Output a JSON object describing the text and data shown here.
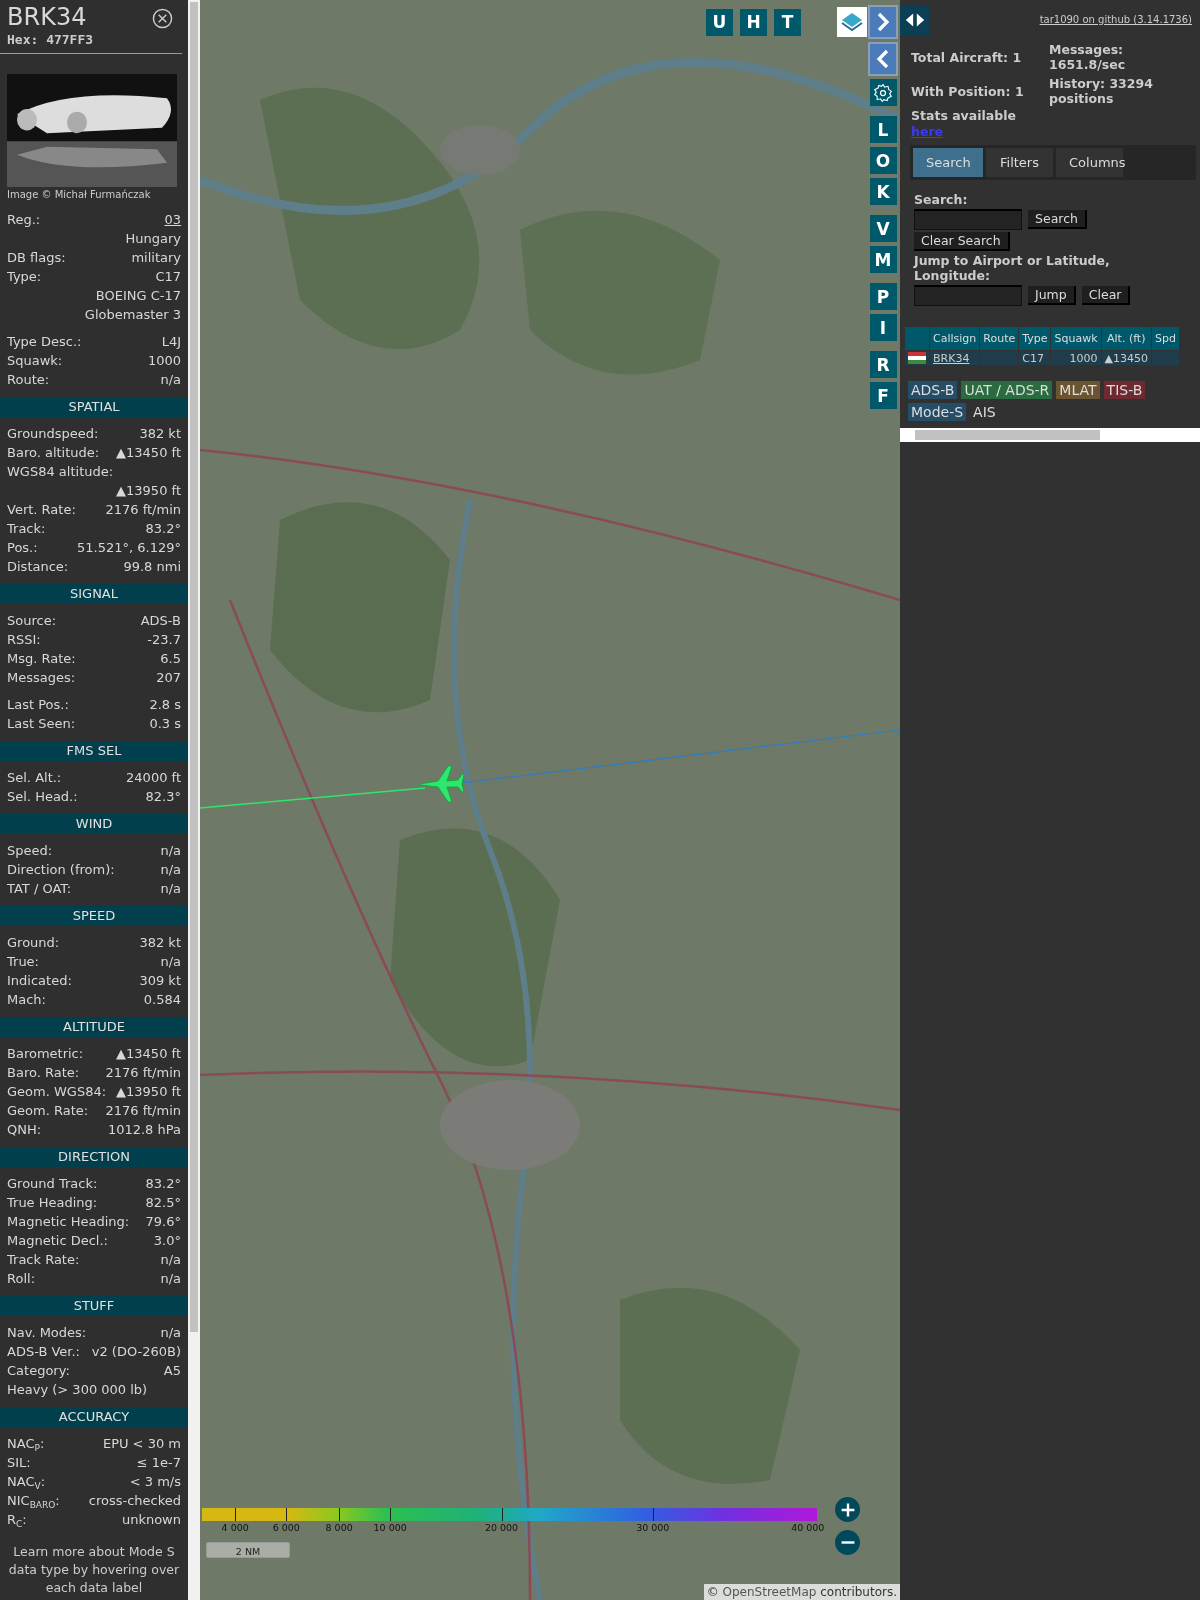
{
  "sidebar": {
    "callsign": "BRK34",
    "hex_label": "Hex:",
    "hex": "477FF3",
    "photo": {
      "kind": "picture"
    },
    "photo_credit": "Image © Michał Furmańczak",
    "info": [
      [
        {
          "kind": "link",
          "label": "Reg.:",
          "value": "03"
        },
        {
          "kind": "value",
          "value": "Hungary"
        },
        {
          "kind": "pair",
          "label": "DB flags:",
          "value": "military"
        },
        {
          "kind": "pair",
          "label": "Type:",
          "value": "C17"
        },
        {
          "kind": "value",
          "value": "BOEING C-17 Globemaster 3"
        }
      ],
      [
        {
          "kind": "pair",
          "label": "Type Desc.:",
          "value": "L4J"
        },
        {
          "kind": "pair",
          "label": "Squawk:",
          "value": "1000"
        },
        {
          "kind": "pair",
          "label": "Route:",
          "value": "n/a"
        }
      ]
    ],
    "sections": [
      {
        "title": "SPATIAL",
        "groups": [
          [
            {
              "kind": "pair",
              "label": "Groundspeed:",
              "value": "382 kt"
            },
            {
              "kind": "pair",
              "label": "Baro. altitude:",
              "value": "▲13450 ft"
            },
            {
              "kind": "label",
              "label": "WGS84 altitude:"
            },
            {
              "kind": "value",
              "value": "▲13950 ft"
            },
            {
              "kind": "pair",
              "label": "Vert. Rate:",
              "value": "2176 ft/min"
            },
            {
              "kind": "pair",
              "label": "Track:",
              "value": "83.2°"
            },
            {
              "kind": "pair",
              "label": "Pos.:",
              "value": "51.521°, 6.129°"
            },
            {
              "kind": "pair",
              "label": "Distance:",
              "value": "99.8 nmi"
            }
          ]
        ]
      },
      {
        "title": "SIGNAL",
        "groups": [
          [
            {
              "kind": "pair",
              "label": "Source:",
              "value": "ADS-B"
            },
            {
              "kind": "pair",
              "label": "RSSI:",
              "value": "-23.7"
            },
            {
              "kind": "pair",
              "label": "Msg. Rate:",
              "value": "6.5"
            },
            {
              "kind": "pair",
              "label": "Messages:",
              "value": "207"
            }
          ],
          [
            {
              "kind": "pair",
              "label": "Last Pos.:",
              "value": "2.8 s"
            },
            {
              "kind": "pair",
              "label": "Last Seen:",
              "value": "0.3 s"
            }
          ]
        ]
      },
      {
        "title": "FMS SEL",
        "groups": [
          [
            {
              "kind": "pair",
              "label": "Sel. Alt.:",
              "value": "24000 ft"
            },
            {
              "kind": "pair",
              "label": "Sel. Head.:",
              "value": "82.3°"
            }
          ]
        ]
      },
      {
        "title": "WIND",
        "groups": [
          [
            {
              "kind": "pair",
              "label": "Speed:",
              "value": "n/a"
            },
            {
              "kind": "pair",
              "label": "Direction (from):",
              "value": "n/a"
            },
            {
              "kind": "pair",
              "label": "TAT / OAT:",
              "value": "n/a"
            }
          ]
        ]
      },
      {
        "title": "SPEED",
        "groups": [
          [
            {
              "kind": "pair",
              "label": "Ground:",
              "value": "382 kt"
            },
            {
              "kind": "pair",
              "label": "True:",
              "value": "n/a"
            },
            {
              "kind": "pair",
              "label": "Indicated:",
              "value": "309 kt"
            },
            {
              "kind": "pair",
              "label": "Mach:",
              "value": "0.584"
            }
          ]
        ]
      },
      {
        "title": "ALTITUDE",
        "groups": [
          [
            {
              "kind": "pair",
              "label": "Barometric:",
              "value": "▲13450 ft"
            },
            {
              "kind": "pair",
              "label": "Baro. Rate:",
              "value": "2176 ft/min"
            },
            {
              "kind": "pair",
              "label": "Geom. WGS84:",
              "value": "▲13950 ft"
            },
            {
              "kind": "pair",
              "label": "Geom. Rate:",
              "value": "2176 ft/min"
            },
            {
              "kind": "pair",
              "label": "QNH:",
              "value": "1012.8 hPa"
            }
          ]
        ]
      },
      {
        "title": "DIRECTION",
        "groups": [
          [
            {
              "kind": "pair",
              "label": "Ground Track:",
              "value": "83.2°"
            },
            {
              "kind": "pair",
              "label": "True Heading:",
              "value": "82.5°"
            },
            {
              "kind": "pair",
              "label": "Magnetic Heading:",
              "value": "79.6°"
            },
            {
              "kind": "pair",
              "label": "Magnetic Decl.:",
              "value": "3.0°"
            },
            {
              "kind": "pair",
              "label": "Track Rate:",
              "value": "n/a"
            },
            {
              "kind": "pair",
              "label": "Roll:",
              "value": "n/a"
            }
          ]
        ]
      },
      {
        "title": "STUFF",
        "groups": [
          [
            {
              "kind": "pair",
              "label": "Nav. Modes:",
              "value": "n/a"
            },
            {
              "kind": "pair",
              "label": "ADS-B Ver.:",
              "value": "v2 (DO-260B)"
            },
            {
              "kind": "pair",
              "label": "Category:",
              "value": "A5"
            },
            {
              "kind": "label",
              "label": "Heavy (> 300 000 lb)"
            }
          ]
        ]
      },
      {
        "title": "ACCURACY",
        "groups": [
          [
            {
              "kind": "pair",
              "label": "NAC$_{P}$:",
              "value": "EPU < 30 m"
            },
            {
              "kind": "pair",
              "label": "SIL:",
              "value": "≤ 1e-7"
            },
            {
              "kind": "pair",
              "label": "NAC$_{V}$:",
              "value": "< 3 m/s"
            },
            {
              "kind": "pair",
              "label": "NIC$_{BARO}$:",
              "value": "cross-checked"
            },
            {
              "kind": "pair",
              "label": "R$_{C}$:",
              "value": "unknown"
            }
          ]
        ]
      }
    ],
    "footer": "Learn more about Mode S data type by hovering over each data label"
  },
  "map": {
    "top_buttons": [
      "U",
      "H",
      "T"
    ],
    "side_buttons": [
      [
        "L",
        "O",
        "K"
      ],
      [
        "V",
        "M"
      ],
      [
        "P",
        "I"
      ],
      [
        "R",
        "F"
      ]
    ],
    "altitude_ticks": [
      "4 000",
      "6 000",
      "8 000",
      "10 000",
      "20 000",
      "30 000",
      "40 000"
    ],
    "scale": "2 NM",
    "attribution_prefix": "©",
    "attribution_link": "OpenStreetMap",
    "attribution_suffix": "contributors."
  },
  "panel": {
    "github_link": "tar1090 on github (3.14.1736)",
    "stats": [
      {
        "label": "Total Aircraft:",
        "value": "1"
      },
      {
        "label": "With Position:",
        "value": "1"
      },
      {
        "label": "Messages:",
        "value": "1651.8/sec"
      },
      {
        "label": "History:",
        "value": "33294 positions"
      }
    ],
    "stats_note": "Stats available",
    "stats_link": "here",
    "tabs": [
      {
        "label": "Search",
        "selected": true
      },
      {
        "label": "Filters",
        "selected": false
      },
      {
        "label": "Columns",
        "selected": false
      }
    ],
    "search_label": "Search:",
    "search_button": "Search",
    "clear_search_button": "Clear Search",
    "jump_label": "Jump to Airport or Latitude, Longitude:",
    "jump_button": "Jump",
    "clear_button": "Clear",
    "table": {
      "columns": [
        "Callsign",
        "Route",
        "Type",
        "Squawk",
        "Alt. (ft)",
        "Spd"
      ],
      "rows": [
        {
          "callsign": "BRK34",
          "type": "C17",
          "squawk": "1000",
          "altitude": "▲13450"
        }
      ]
    },
    "legend": [
      {
        "label": "ADS-B",
        "color": "#264d66"
      },
      {
        "label": "UAT / ADS-R",
        "color": "#2a6b40"
      },
      {
        "label": "MLAT",
        "color": "#6b5530"
      },
      {
        "label": "TIS-B",
        "color": "#6e2a30"
      },
      {
        "label": "Mode-S",
        "color": "#264d66"
      },
      {
        "label": "AIS"
      }
    ]
  }
}
